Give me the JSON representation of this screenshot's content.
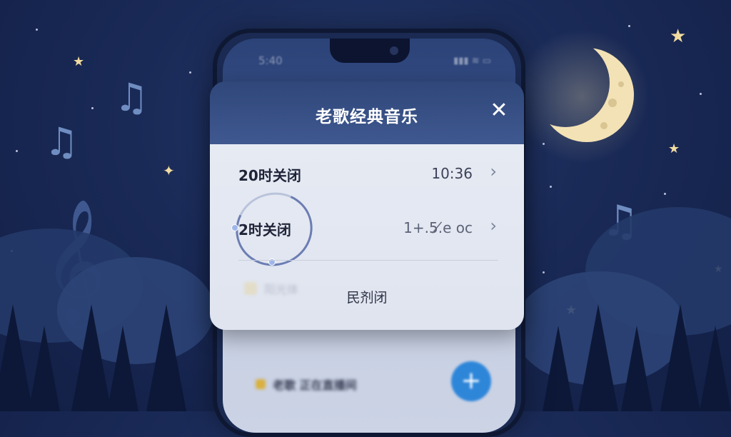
{
  "background": {
    "palette": {
      "sky": "#1a2a57",
      "moon": "#f3e2b5",
      "accent": "#7f9fd4"
    }
  },
  "phone": {
    "status_time": "5:40",
    "status_icons": "▮▮▮ ≋ ▭",
    "bg_text": "老歌 正在直播间",
    "fab_icon": "plus-icon"
  },
  "dialog": {
    "title": "老歌经典音乐",
    "close_icon": "close-icon",
    "options": [
      {
        "label": "20时关闭",
        "value": "10:36"
      },
      {
        "label": "2时关闭",
        "value": "1+.5.̸e oc"
      }
    ],
    "ghost_text": "阳光体",
    "footer_button": "民剂闭"
  }
}
